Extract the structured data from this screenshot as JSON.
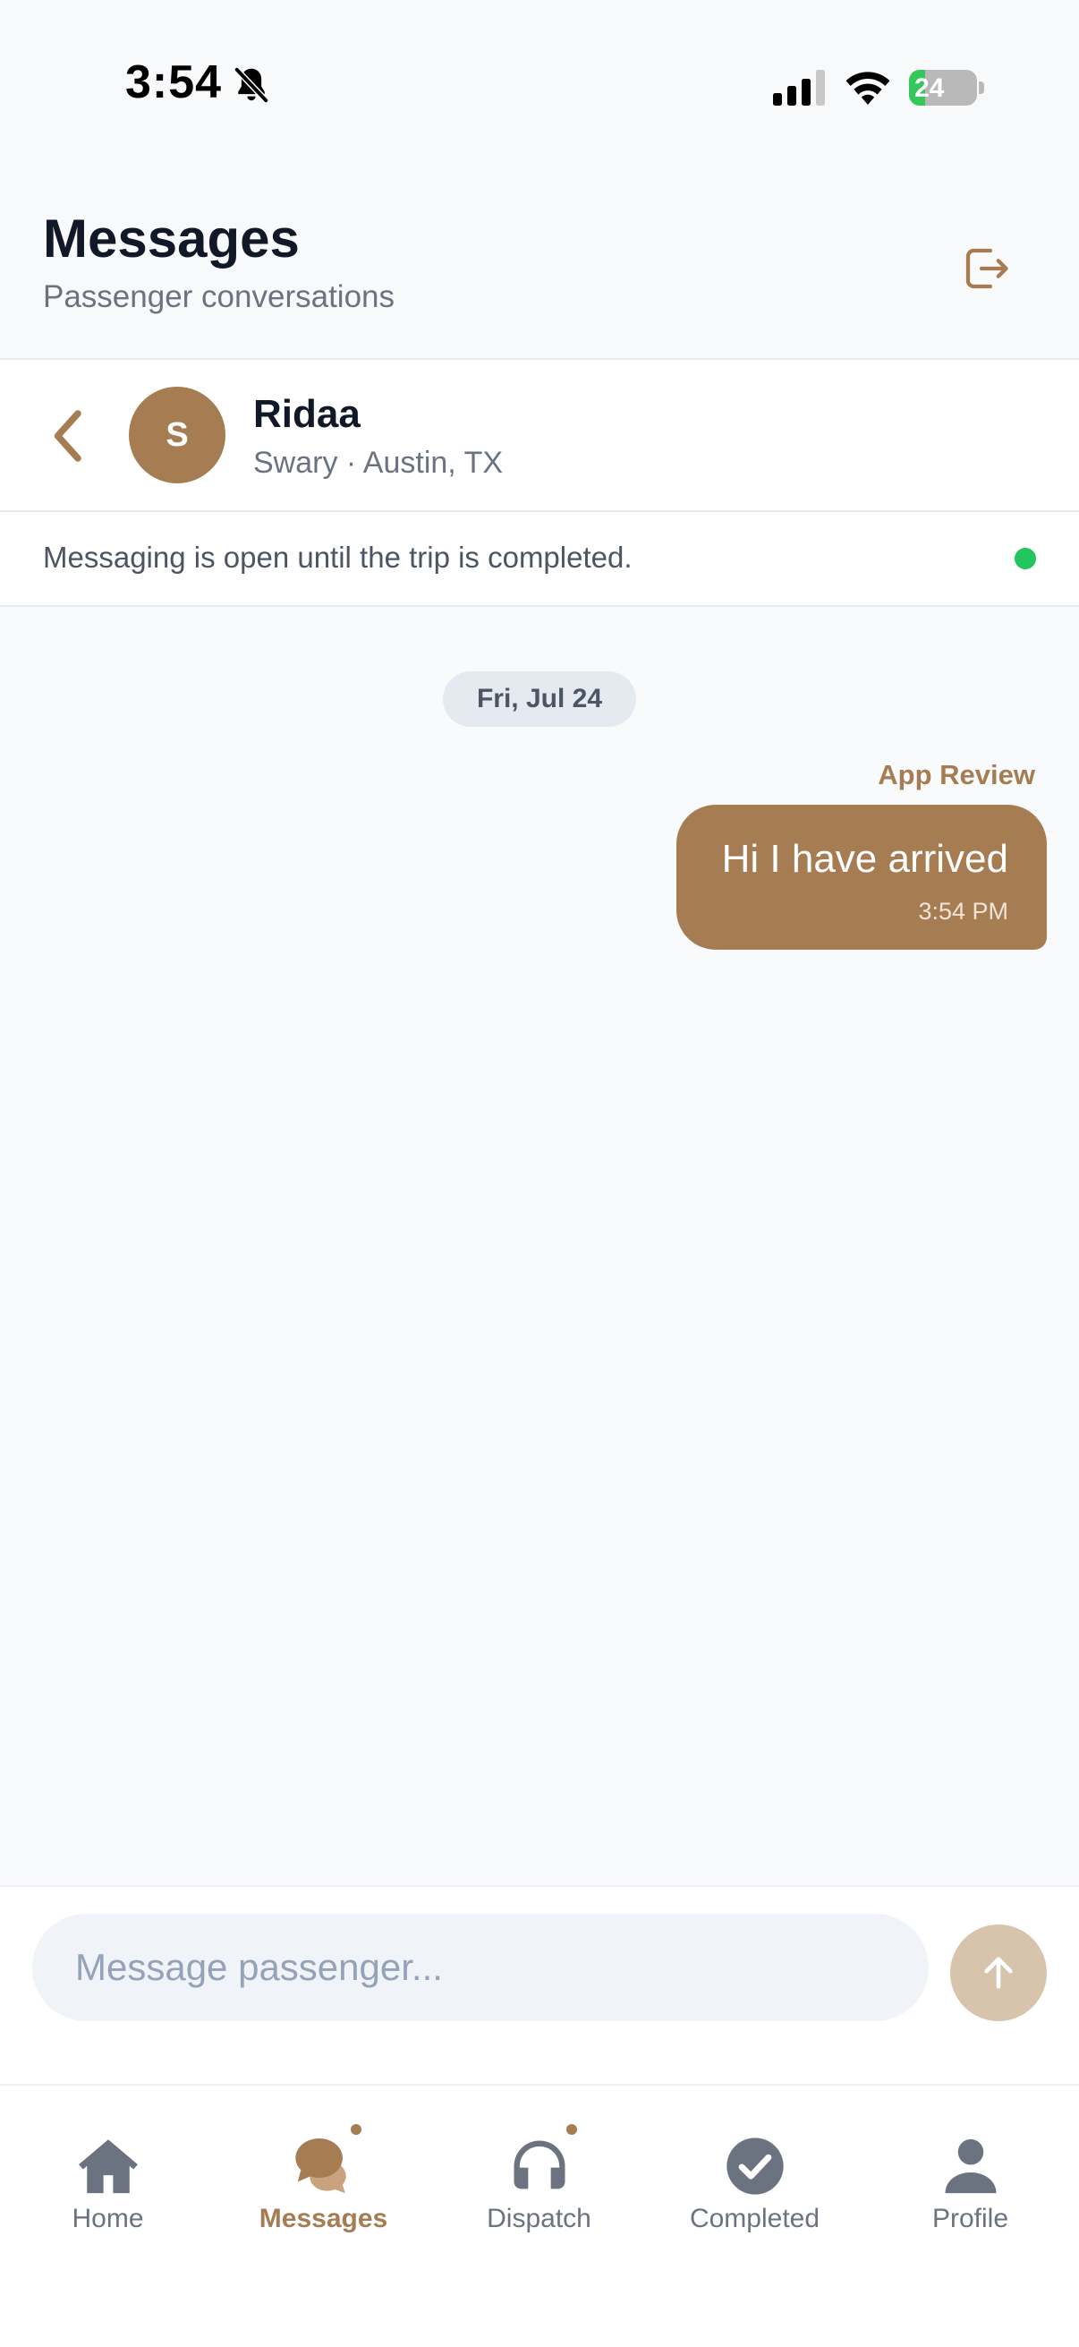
{
  "status_bar": {
    "time": "3:54",
    "battery": "24",
    "battery_fraction": 0.24
  },
  "header": {
    "title": "Messages",
    "subtitle": "Passenger conversations"
  },
  "conversation": {
    "avatar_initial": "S",
    "name": "Ridaa",
    "subtitle": "Swary · Austin, TX",
    "notice": "Messaging is open until the trip is completed."
  },
  "chat": {
    "date_label": "Fri, Jul 24",
    "messages": [
      {
        "sender": "App Review",
        "text": "Hi I have arrived",
        "time": "3:54 PM"
      }
    ]
  },
  "composer": {
    "placeholder": "Message passenger..."
  },
  "nav": {
    "items": [
      {
        "label": "Home",
        "icon": "home-icon"
      },
      {
        "label": "Messages",
        "icon": "chat-bubbles-icon",
        "active": true,
        "badge": true
      },
      {
        "label": "Dispatch",
        "icon": "headset-icon",
        "badge": true
      },
      {
        "label": "Completed",
        "icon": "check-circle-icon"
      },
      {
        "label": "Profile",
        "icon": "person-icon"
      }
    ]
  },
  "colors": {
    "accent": "#a67c52",
    "online": "#22c55e",
    "send_button": "#d8c3ad"
  }
}
